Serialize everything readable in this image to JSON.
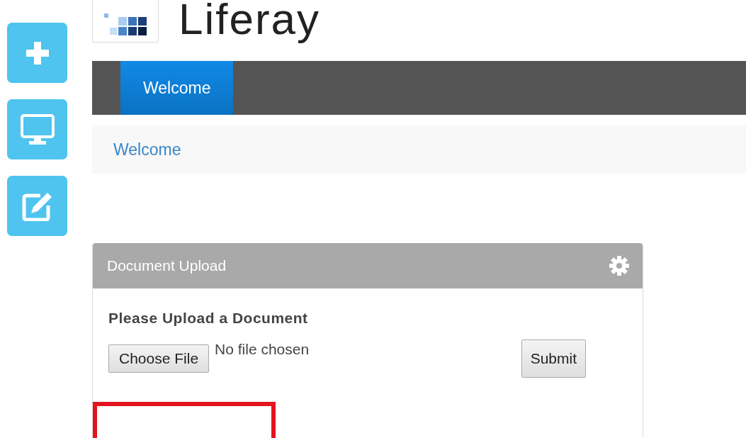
{
  "logo": {
    "text": "Liferay"
  },
  "dock": [
    {
      "kind": "add"
    },
    {
      "kind": "screen"
    },
    {
      "kind": "edit"
    }
  ],
  "nav": {
    "tabs": [
      {
        "label": "Welcome",
        "selected": true
      }
    ]
  },
  "breadcrumb": [
    {
      "label": "Welcome"
    }
  ],
  "portlet": {
    "title": "Document Upload",
    "heading": "Please Upload a Document",
    "file_button": "Choose File",
    "file_status": "No file chosen",
    "submit": "Submit"
  }
}
